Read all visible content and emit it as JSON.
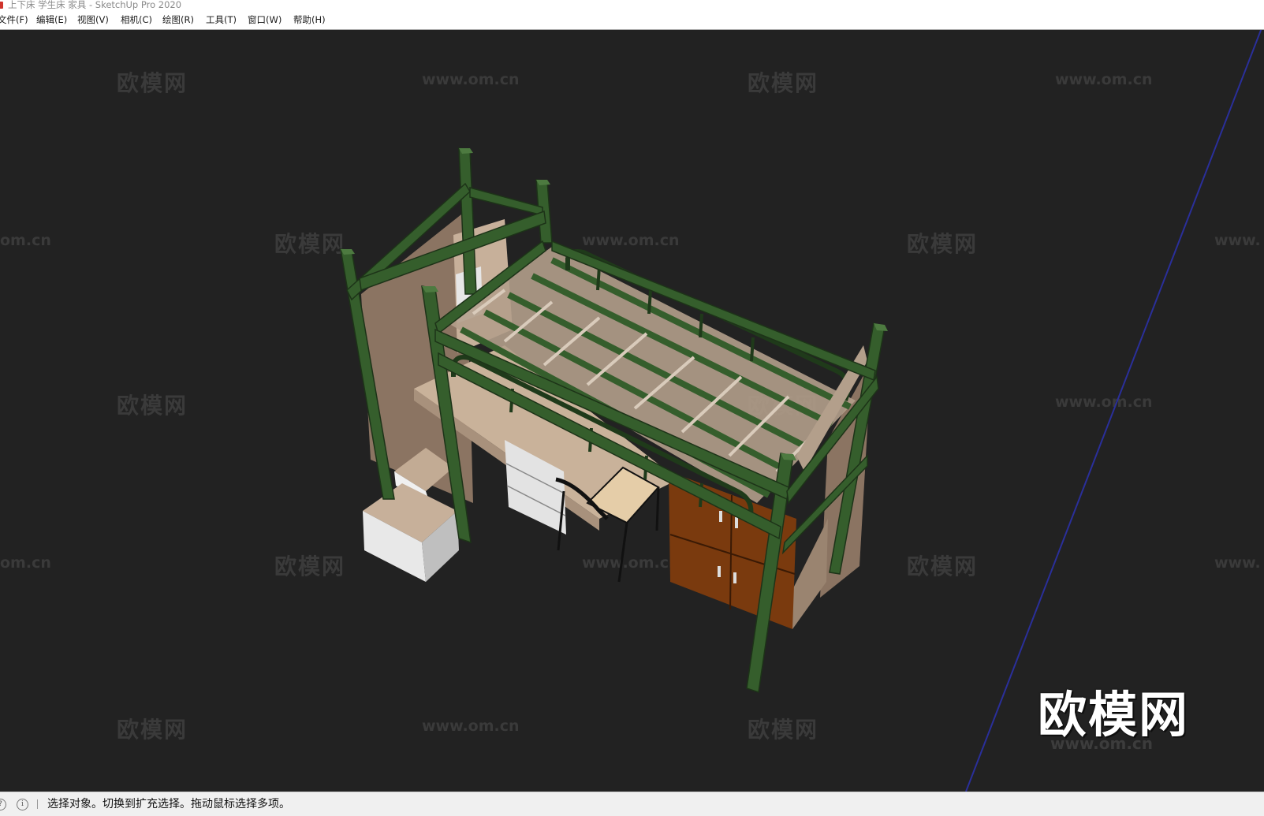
{
  "window": {
    "title": "上下床 学生床 家具 - SketchUp Pro 2020"
  },
  "menu": [
    {
      "label": "文件(F)"
    },
    {
      "label": "编辑(E)"
    },
    {
      "label": "视图(V)"
    },
    {
      "label": "相机(C)"
    },
    {
      "label": "绘图(R)"
    },
    {
      "label": "工具(T)"
    },
    {
      "label": "窗口(W)"
    },
    {
      "label": "帮助(H)"
    }
  ],
  "viewport": {
    "background": "#222222",
    "model": "loft bed with desk, drawers, wardrobe and chair",
    "watermark_logo": "欧模网",
    "watermark_url": "www.om.cn",
    "watermark_url_cut_left": "om.cn",
    "watermark_url_cut_right": "www.",
    "brand_watermark": "欧模网",
    "brand_url": "www.om.cn",
    "colors": {
      "frame": "#355e2c",
      "slats": "#b39f8b",
      "panel": "#8b7462",
      "wardrobe": "#7a3a0e",
      "drawer": "#e6e6e6",
      "axis": "#2a2f9a"
    }
  },
  "status": {
    "help_icon": "question-icon",
    "info_icon": "info-icon",
    "text": "选择对象。切换到扩充选择。拖动鼠标选择多项。"
  }
}
